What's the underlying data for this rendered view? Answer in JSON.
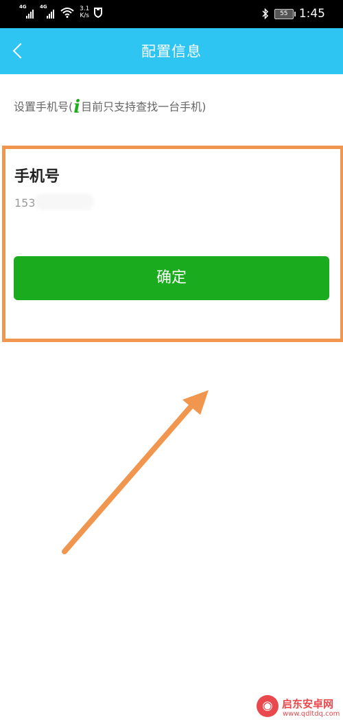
{
  "status_bar": {
    "sim1_label": "4G",
    "sim2_label": "4G",
    "speed_value": "3.1",
    "speed_unit": "K/s",
    "battery": "55",
    "time": "1:45",
    "icons": [
      "signal-icon",
      "wifi-icon",
      "shield-icon",
      "bluetooth-icon",
      "battery-icon"
    ]
  },
  "app_bar": {
    "title": "配置信息",
    "back_icon": "chevron-left-icon",
    "color": "#2ec5f2"
  },
  "hint": {
    "before": "设置手机号(",
    "icon_letter": "i",
    "after": "目前只支持查找一台手机)"
  },
  "form": {
    "phone_label": "手机号",
    "phone_value": "153"
  },
  "confirm": {
    "label": "确定",
    "color": "#1aac1e"
  },
  "annotation": {
    "box_color": "#f0964f"
  },
  "watermark": {
    "name": "启东安卓网",
    "url": "www.qdltdq.com"
  }
}
